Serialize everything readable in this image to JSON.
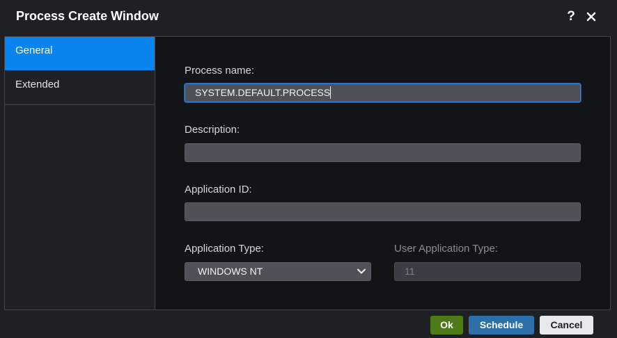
{
  "window": {
    "title": "Process Create Window",
    "help_label": "?",
    "close_icon": "close-icon"
  },
  "sidebar": {
    "items": [
      {
        "label": "General",
        "active": true
      },
      {
        "label": "Extended",
        "active": false
      }
    ]
  },
  "form": {
    "process_name": {
      "label": "Process name:",
      "value": "SYSTEM.DEFAULT.PROCESS"
    },
    "description": {
      "label": "Description:",
      "value": ""
    },
    "application_id": {
      "label": "Application ID:",
      "value": ""
    },
    "application_type": {
      "label": "Application Type:",
      "value": "WINDOWS NT"
    },
    "user_application_type": {
      "label": "User Application Type:",
      "value": "11",
      "disabled": true
    }
  },
  "footer": {
    "ok_label": "Ok",
    "schedule_label": "Schedule",
    "cancel_label": "Cancel"
  },
  "colors": {
    "accent": "#0a84f0",
    "ok": "#4f7a1a",
    "schedule": "#2d6fa8"
  }
}
